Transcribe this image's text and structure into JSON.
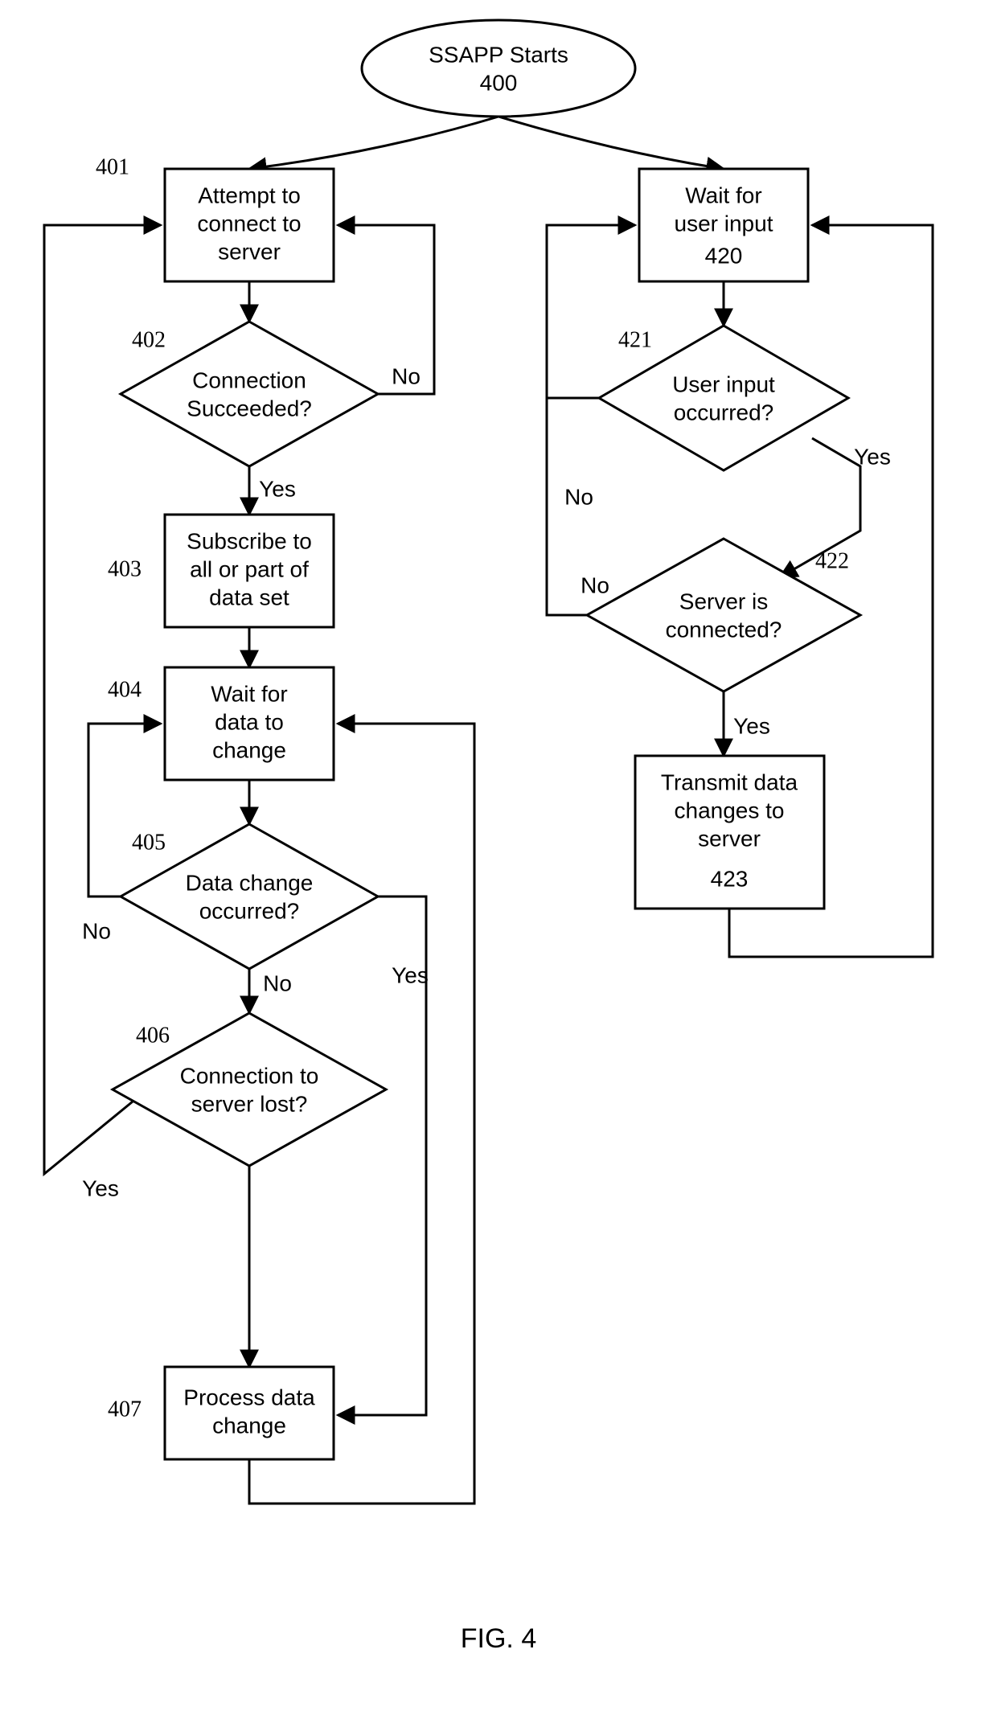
{
  "figure_label": "FIG. 4",
  "start": {
    "ref": "400",
    "line1": "SSAPP Starts"
  },
  "left": {
    "n401": {
      "ref": "401",
      "line1": "Attempt to",
      "line2": "connect to",
      "line3": "server"
    },
    "n402": {
      "ref": "402",
      "line1": "Connection",
      "line2": "Succeeded?"
    },
    "n403": {
      "ref": "403",
      "line1": "Subscribe to",
      "line2": "all or part of",
      "line3": "data set"
    },
    "n404": {
      "ref": "404",
      "line1": "Wait for",
      "line2": "data to",
      "line3": "change"
    },
    "n405": {
      "ref": "405",
      "line1": "Data change",
      "line2": "occurred?"
    },
    "n406": {
      "ref": "406",
      "line1": "Connection to",
      "line2": "server lost?"
    },
    "n407": {
      "ref": "407",
      "line1": "Process data",
      "line2": "change"
    }
  },
  "right": {
    "n420": {
      "ref": "420",
      "line1": "Wait for",
      "line2": "user input"
    },
    "n421": {
      "ref": "421",
      "line1": "User input",
      "line2": "occurred?"
    },
    "n422": {
      "ref": "422",
      "line1": "Server is",
      "line2": "connected?"
    },
    "n423": {
      "ref": "423",
      "line1": "Transmit data",
      "line2": "changes to",
      "line3": "server"
    }
  },
  "edges": {
    "yes": "Yes",
    "no": "No"
  }
}
